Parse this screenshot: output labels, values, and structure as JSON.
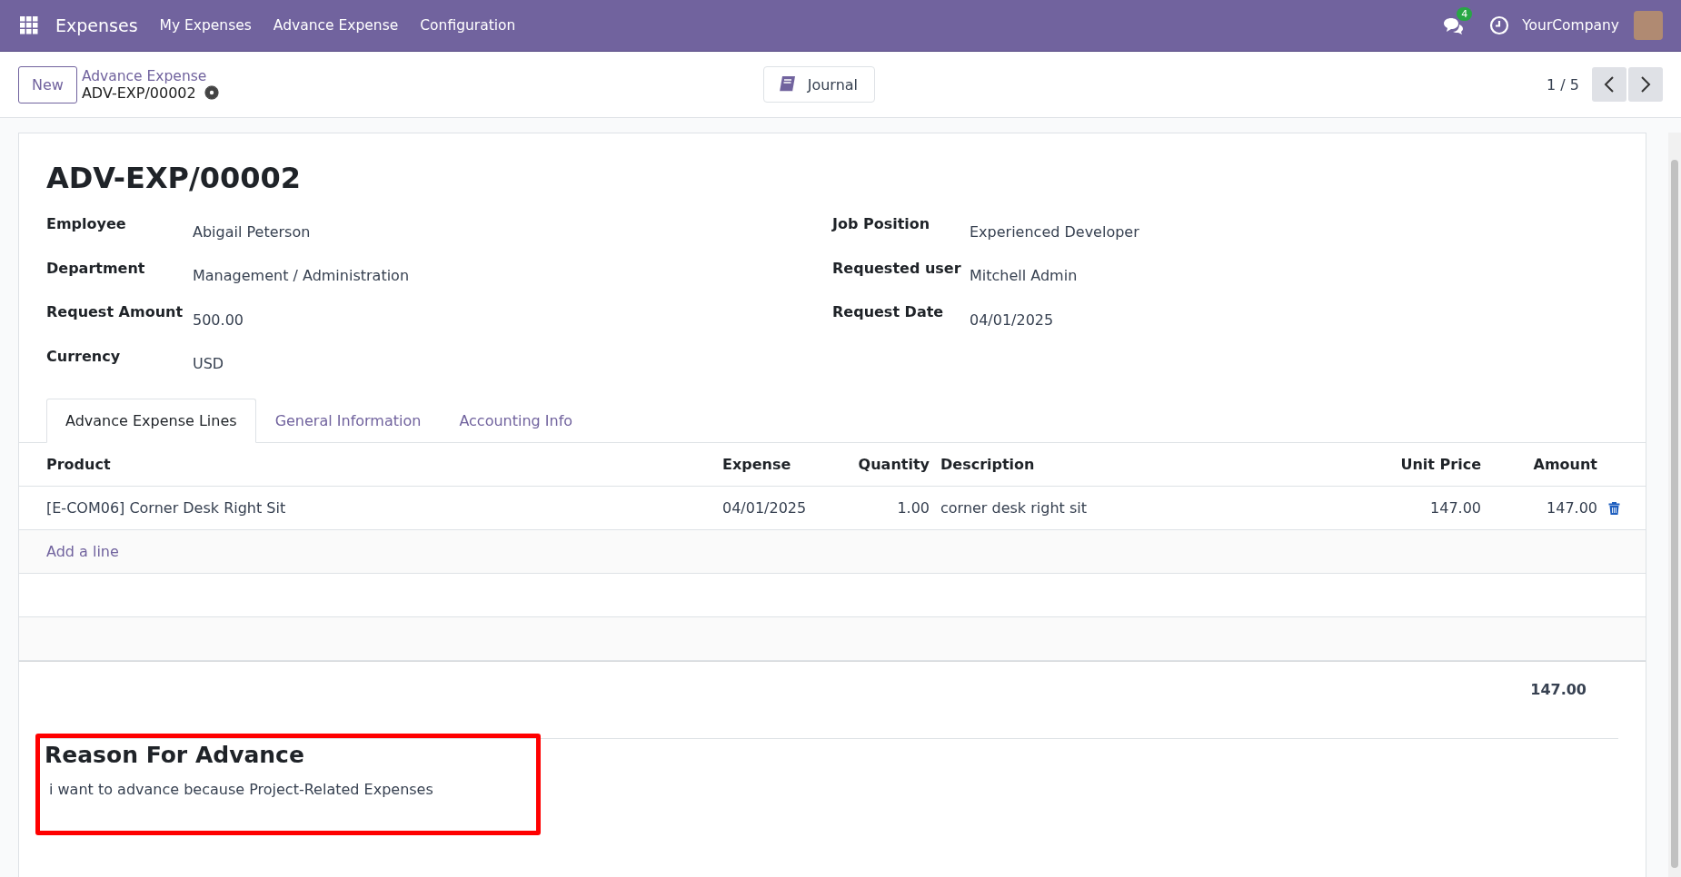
{
  "navbar": {
    "app_name": "Expenses",
    "menu": [
      "My Expenses",
      "Advance Expense",
      "Configuration"
    ],
    "messages_badge": "4",
    "company": "YourCompany"
  },
  "control_panel": {
    "new_button": "New",
    "breadcrumb": "Advance Expense",
    "record_name": "ADV-EXP/00002",
    "journal_button": "Journal",
    "pager": "1 / 5"
  },
  "form": {
    "title": "ADV-EXP/00002",
    "left_fields": [
      {
        "label": "Employee",
        "value": "Abigail Peterson"
      },
      {
        "label": "Department",
        "value": "Management / Administration"
      },
      {
        "label": "Request Amount",
        "value": "500.00"
      },
      {
        "label": "Currency",
        "value": "USD"
      }
    ],
    "right_fields": [
      {
        "label": "Job Position",
        "value": "Experienced Developer"
      },
      {
        "label": "Requested user",
        "value": "Mitchell Admin"
      },
      {
        "label": "Request Date",
        "value": "04/01/2025"
      }
    ],
    "tabs": [
      {
        "label": "Advance Expense Lines",
        "selected": true
      },
      {
        "label": "General Information",
        "selected": false
      },
      {
        "label": "Accounting Info",
        "selected": false
      }
    ],
    "table": {
      "columns": [
        "Product",
        "Expense",
        "Quantity",
        "Description",
        "Unit Price",
        "Amount"
      ],
      "rows": [
        {
          "cells": [
            "[E-COM06] Corner Desk Right Sit",
            "04/01/2025",
            "1.00",
            "corner desk right sit",
            "147.00",
            "147.00"
          ]
        }
      ],
      "add_line": "Add a line",
      "total": "147.00"
    },
    "reason": {
      "heading": "Reason For Advance",
      "text": "i want to advance because Project-Related Expenses",
      "highlighted": true
    }
  }
}
